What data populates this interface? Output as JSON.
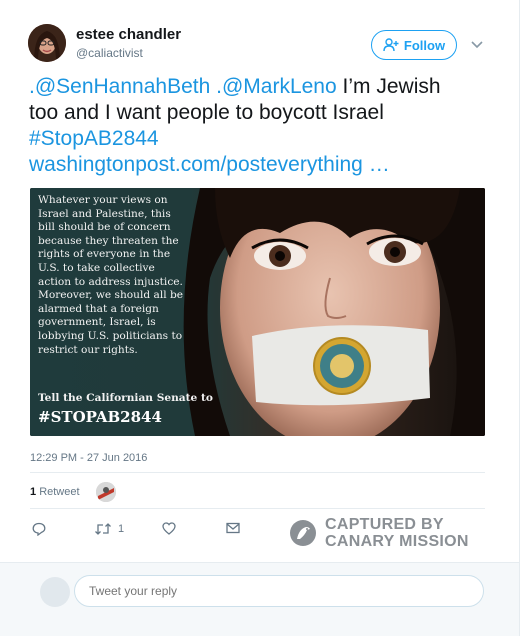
{
  "author": {
    "name": "estee chandler",
    "handle": "@caliactivist"
  },
  "follow_button": {
    "label": "Follow"
  },
  "tweet": {
    "mention1": ".@SenHannahBeth",
    "mention2": ".@MarkLeno",
    "text_line1": "I’m Jewish",
    "text_line2": "too and I want people to boycott Israel",
    "hashtag": "#StopAB2844",
    "url": "washingtonpost.com/posteverything",
    "ellipsis": "…"
  },
  "media": {
    "overlay_text": "Whatever your views on Israel and Palestine, this bill should be of concern because they threaten the rights of everyone in the U.S. to take collective action to address injustice. Moreover, we should all be alarmed that a foreign government, Israel, is lobbying U.S. politicians to restrict our rights.",
    "cta": "Tell the Californian Senate to",
    "tag": "#STOPAB2844"
  },
  "timestamp": "12:29 PM - 27 Jun 2016",
  "stats": {
    "retweet_count": "1",
    "retweet_label": "Retweet"
  },
  "actions": {
    "reply_icon": "reply-icon",
    "retweet_icon": "retweet-icon",
    "retweet_count": "1",
    "like_icon": "heart-icon",
    "dm_icon": "envelope-icon"
  },
  "watermark": {
    "line1": "CAPTURED BY",
    "line2": "CANARY MISSION"
  },
  "reply": {
    "placeholder": "Tweet your reply"
  },
  "colors": {
    "link": "#1b95e0",
    "accent": "#1da1f2",
    "muted": "#657786",
    "watermark": "#8a8f94"
  }
}
